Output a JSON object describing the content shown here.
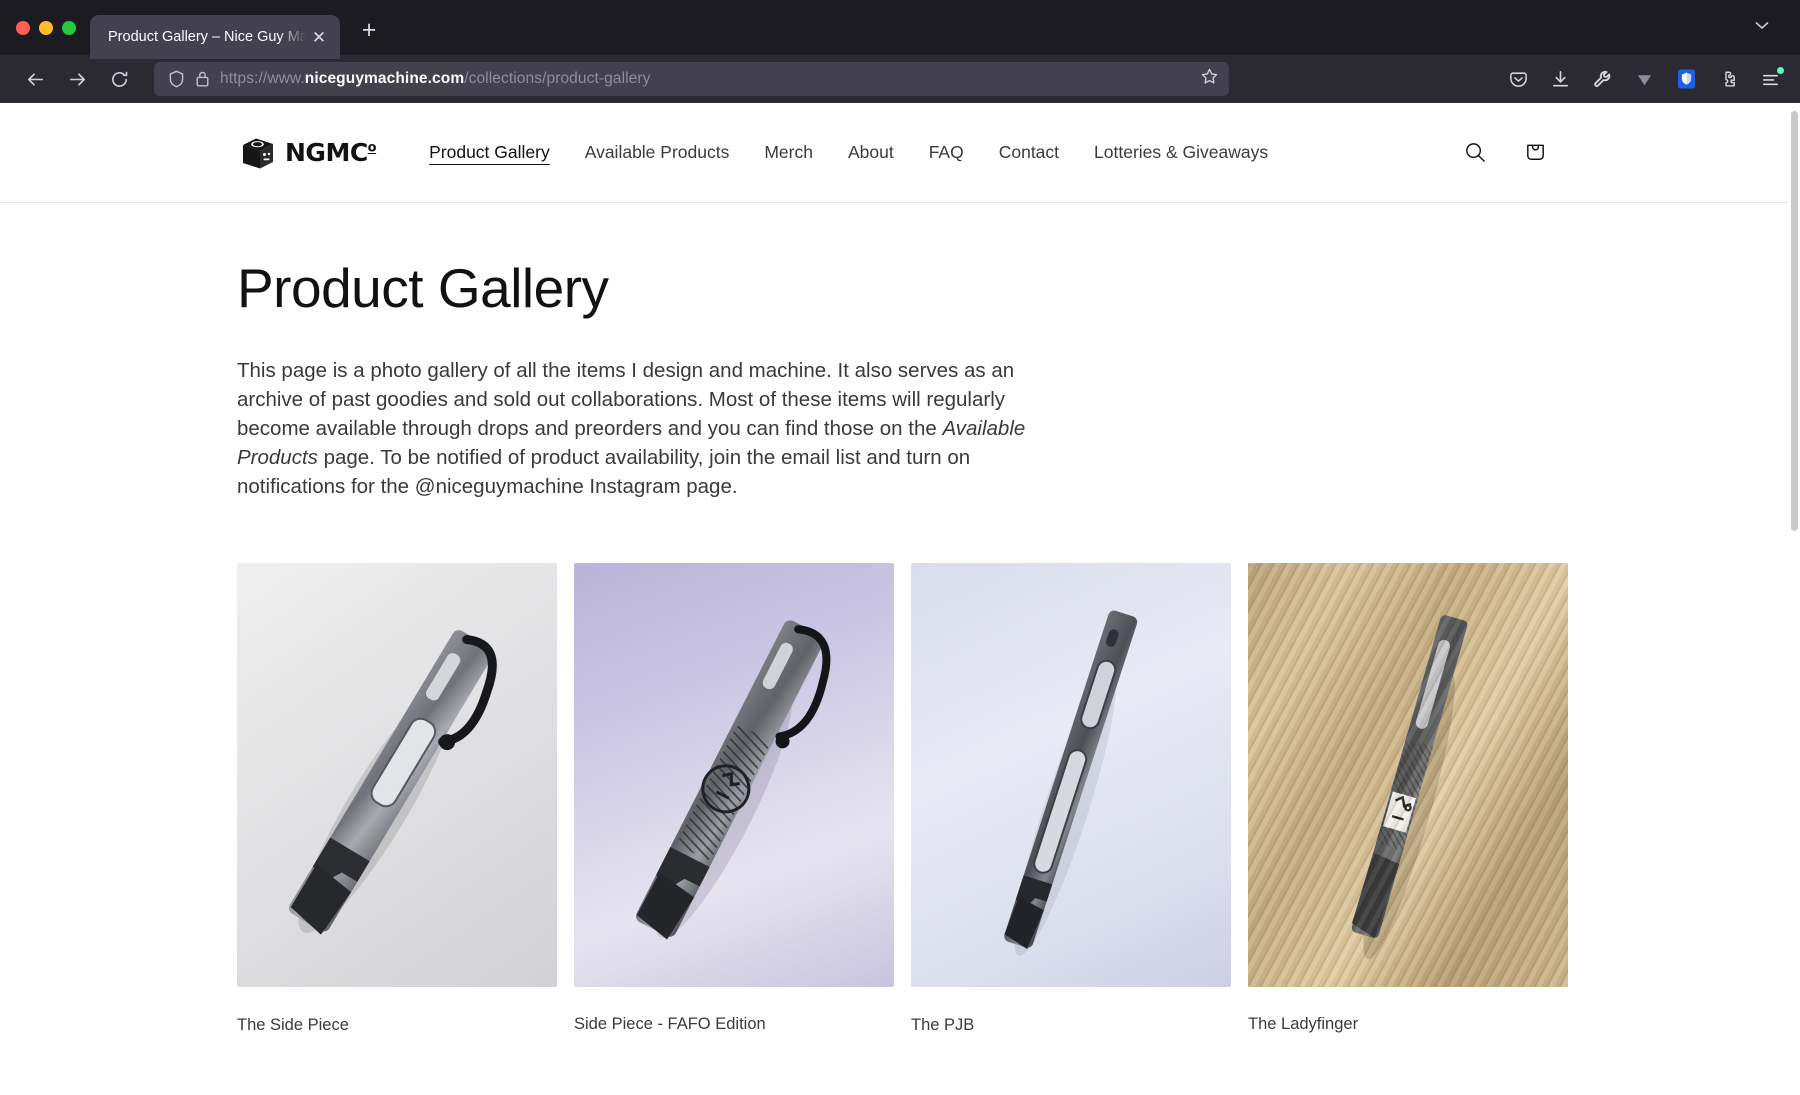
{
  "browser": {
    "tab": {
      "title": "Product Gallery – Nice Guy Machine",
      "close_label": "✕"
    },
    "new_tab_label": "+",
    "url": {
      "scheme": "https://www.",
      "host": "niceguymachine.com",
      "path": "/collections/product-gallery"
    },
    "toolbar_icons": [
      "pocket-icon",
      "downloads-icon",
      "wrench-icon",
      "vimium-icon",
      "shield-icon",
      "extensions-icon",
      "app-menu-icon"
    ],
    "nav_icons": [
      "back-icon",
      "forward-icon",
      "reload-icon"
    ],
    "accent_blue": "#1e5ee8",
    "green_badge": "#54ffbd"
  },
  "site": {
    "logo_text": "NGMC",
    "logo_sup": "o",
    "nav": [
      {
        "label": "Product Gallery",
        "active": true
      },
      {
        "label": "Available Products",
        "active": false
      },
      {
        "label": "Merch",
        "active": false
      },
      {
        "label": "About",
        "active": false
      },
      {
        "label": "FAQ",
        "active": false
      },
      {
        "label": "Contact",
        "active": false
      },
      {
        "label": "Lotteries & Giveaways",
        "active": false
      }
    ],
    "actions": [
      "search-icon",
      "cart-icon"
    ]
  },
  "main": {
    "title": "Product Gallery",
    "intro_part1": "This page is a photo gallery of all the items I design and machine. It also serves as an archive of past goodies and sold out collaborations. Most of these items will regularly become available through drops and preorders and you can find those on the ",
    "intro_italic": "Available Products",
    "intro_part2": " page.  To be notified of product availability, join the email list and turn on notifications for the @niceguymachine Instagram page.",
    "products": [
      {
        "caption": "The Side Piece"
      },
      {
        "caption": "Side Piece - FAFO Edition"
      },
      {
        "caption": "The PJB"
      },
      {
        "caption": "The Ladyfinger"
      }
    ]
  }
}
